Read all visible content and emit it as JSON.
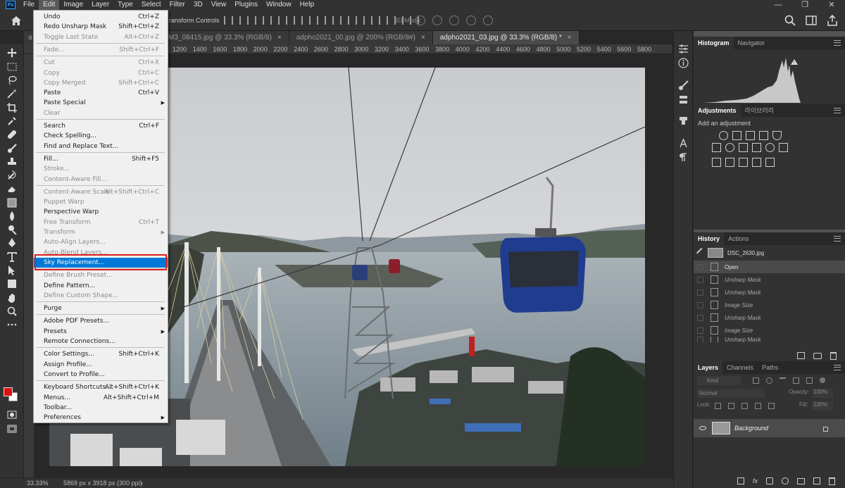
{
  "menubar": {
    "logo": "Ps",
    "items": [
      "File",
      "Edit",
      "Image",
      "Layer",
      "Type",
      "Select",
      "Filter",
      "3D",
      "View",
      "Plugins",
      "Window",
      "Help"
    ],
    "controls": [
      "—",
      "❐",
      "✕"
    ]
  },
  "options": {
    "transform_label": "ransform Controls",
    "mode3d": "3D Mode:"
  },
  "tabs": [
    {
      "label": "a"
    },
    {
      "label": "M3_08415.jpg @ 33.3% (RGB/8)",
      "close": "×"
    },
    {
      "label": "adpho2021_00.jpg @ 200% (RGB/8#)",
      "close": "×"
    },
    {
      "label": "adpho2021_03.jpg @ 33.3% (RGB/8) *",
      "close": "×"
    }
  ],
  "ruler": [
    "1200",
    "1400",
    "1600",
    "1800",
    "2000",
    "2200",
    "2400",
    "2600",
    "2800",
    "3000",
    "3200",
    "3400",
    "3600",
    "3800",
    "4000",
    "4200",
    "4400",
    "4600",
    "4800",
    "5000",
    "5200",
    "5400",
    "5600",
    "5800"
  ],
  "status": {
    "zoom": "33.33%",
    "doc_info": "5869 px x 3918 px (300 ppi)",
    "arrow": "›"
  },
  "edit_menu": [
    {
      "label": "Undo",
      "shortcut": "Ctrl+Z",
      "disabled": false
    },
    {
      "label": "Redo Unsharp Mask",
      "shortcut": "Shift+Ctrl+Z",
      "disabled": false
    },
    {
      "label": "Toggle Last State",
      "shortcut": "Alt+Ctrl+Z",
      "disabled": true
    },
    {
      "sep": true
    },
    {
      "label": "Fade...",
      "shortcut": "Shift+Ctrl+F",
      "disabled": true
    },
    {
      "sep": true
    },
    {
      "label": "Cut",
      "shortcut": "Ctrl+X",
      "disabled": true
    },
    {
      "label": "Copy",
      "shortcut": "Ctrl+C",
      "disabled": true
    },
    {
      "label": "Copy Merged",
      "shortcut": "Shift+Ctrl+C",
      "disabled": true
    },
    {
      "label": "Paste",
      "shortcut": "Ctrl+V",
      "disabled": false
    },
    {
      "label": "Paste Special",
      "shortcut": "",
      "disabled": false,
      "submenu": true
    },
    {
      "label": "Clear",
      "shortcut": "",
      "disabled": true
    },
    {
      "sep": true
    },
    {
      "label": "Search",
      "shortcut": "Ctrl+F",
      "disabled": false
    },
    {
      "label": "Check Spelling...",
      "shortcut": "",
      "disabled": false
    },
    {
      "label": "Find and Replace Text...",
      "shortcut": "",
      "disabled": false
    },
    {
      "sep": true
    },
    {
      "label": "Fill...",
      "shortcut": "Shift+F5",
      "disabled": false
    },
    {
      "label": "Stroke...",
      "shortcut": "",
      "disabled": true
    },
    {
      "label": "Content-Aware Fill...",
      "shortcut": "",
      "disabled": true
    },
    {
      "sep": true
    },
    {
      "label": "Content-Aware Scale",
      "shortcut": "Alt+Shift+Ctrl+C",
      "disabled": true
    },
    {
      "label": "Puppet Warp",
      "shortcut": "",
      "disabled": true
    },
    {
      "label": "Perspective Warp",
      "shortcut": "",
      "disabled": false
    },
    {
      "label": "Free Transform",
      "shortcut": "Ctrl+T",
      "disabled": true
    },
    {
      "label": "Transform",
      "shortcut": "",
      "disabled": true,
      "submenu": true
    },
    {
      "label": "Auto-Align Layers...",
      "shortcut": "",
      "disabled": true
    },
    {
      "label": "Auto-Blend Layers...",
      "shortcut": "",
      "disabled": true
    },
    {
      "label": "Sky Replacement...",
      "shortcut": "",
      "disabled": false,
      "highlighted": true
    },
    {
      "sep": true
    },
    {
      "label": "Define Brush Preset...",
      "shortcut": "",
      "disabled": true
    },
    {
      "label": "Define Pattern...",
      "shortcut": "",
      "disabled": false
    },
    {
      "label": "Define Custom Shape...",
      "shortcut": "",
      "disabled": true
    },
    {
      "sep": true
    },
    {
      "label": "Purge",
      "shortcut": "",
      "disabled": false,
      "submenu": true
    },
    {
      "sep": true
    },
    {
      "label": "Adobe PDF Presets...",
      "shortcut": "",
      "disabled": false
    },
    {
      "label": "Presets",
      "shortcut": "",
      "disabled": false,
      "submenu": true
    },
    {
      "label": "Remote Connections...",
      "shortcut": "",
      "disabled": false
    },
    {
      "sep": true
    },
    {
      "label": "Color Settings...",
      "shortcut": "Shift+Ctrl+K",
      "disabled": false
    },
    {
      "label": "Assign Profile...",
      "shortcut": "",
      "disabled": false
    },
    {
      "label": "Convert to Profile...",
      "shortcut": "",
      "disabled": false
    },
    {
      "sep": true
    },
    {
      "label": "Keyboard Shortcuts...",
      "shortcut": "Alt+Shift+Ctrl+K",
      "disabled": false
    },
    {
      "label": "Menus...",
      "shortcut": "Alt+Shift+Ctrl+M",
      "disabled": false
    },
    {
      "label": "Toolbar...",
      "shortcut": "",
      "disabled": false
    },
    {
      "label": "Preferences",
      "shortcut": "",
      "disabled": false,
      "submenu": true
    }
  ],
  "panels": {
    "histogram": {
      "tabs": [
        "Histogram",
        "Navigator"
      ],
      "warning": "!"
    },
    "adjustments": {
      "tabs": [
        "Adjustments",
        "라이브러리"
      ],
      "add_label": "Add an adjustment"
    },
    "history": {
      "tabs": [
        "History",
        "Actions"
      ],
      "snapshot": "DSC_2630.jpg",
      "states": [
        "Open",
        "Unsharp Mask",
        "Unsharp Mask",
        "Image Size",
        "Unsharp Mask",
        "Image Size",
        "Unsharp Mask"
      ]
    },
    "layers": {
      "tabs": [
        "Layers",
        "Channels",
        "Paths"
      ],
      "kind": "Kind",
      "blend": "Normal",
      "opacity_label": "Opacity:",
      "opacity": "100%",
      "lock_label": "Lock:",
      "fill_label": "Fill:",
      "fill": "100%",
      "layer_name": "Background"
    }
  },
  "colors": {
    "foreground": "#e01010",
    "background": "#ffffff",
    "highlight": "#0078d7",
    "callout": "#e02020"
  }
}
